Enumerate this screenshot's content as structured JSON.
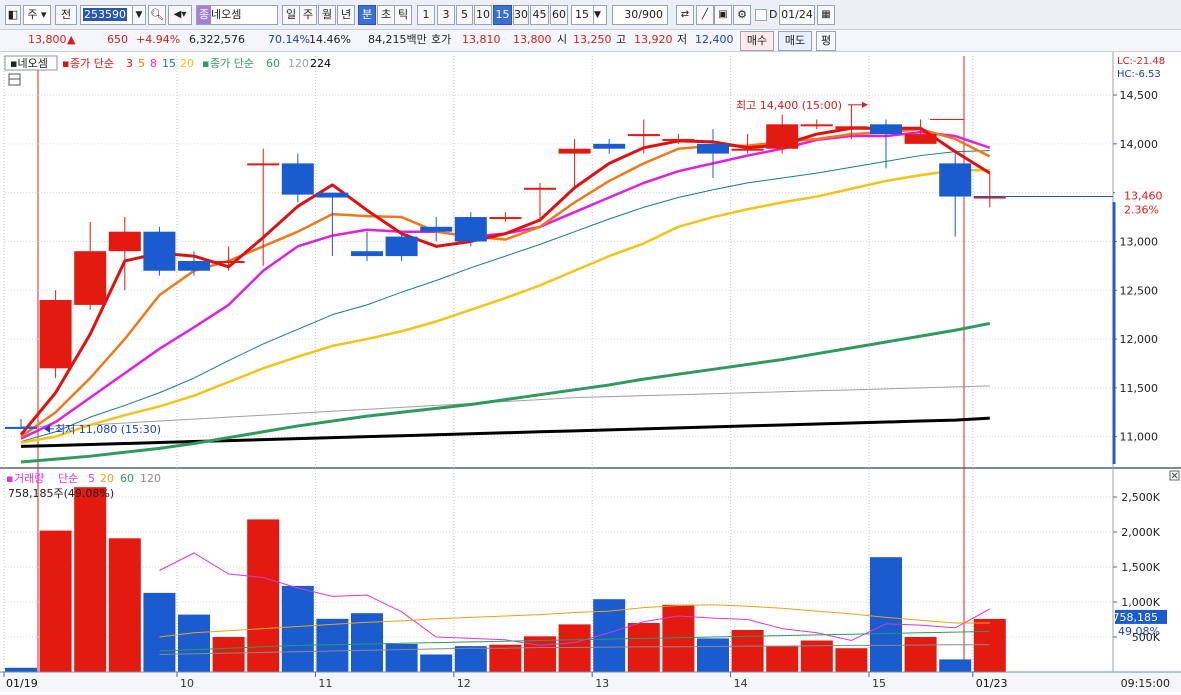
{
  "toolbar": {
    "market": "주",
    "all": "전",
    "code": "253590",
    "type_badge": "종",
    "stock_name": "네오셈",
    "periods": [
      "일",
      "주",
      "월",
      "년",
      "분",
      "초",
      "틱"
    ],
    "active_period": "분",
    "intervals": [
      "1",
      "3",
      "5",
      "10",
      "15",
      "30",
      "45",
      "60"
    ],
    "active_interval": "15",
    "interval_value": "15",
    "count": "30/900",
    "d_label": "D",
    "date": "01/24"
  },
  "quote": {
    "price": "13,800",
    "arrow": "▲",
    "change": "650",
    "change_rate": "+4.94%",
    "volume": "6,322,576",
    "vol_ratio": "70.14%",
    "turnover": "14.46%",
    "amount": "84,215백만",
    "ask_label": "호가",
    "ask1": "13,810",
    "bid1": "13,800",
    "open_label": "시",
    "open": "13,250",
    "high_label": "고",
    "high": "13,920",
    "low_label": "저",
    "low": "12,400",
    "buy_button": "매수",
    "sell_button": "매도",
    "eval_button": "평"
  },
  "legend": {
    "name": "네오셈",
    "ma_title": "종가 단순",
    "ma_periods": [
      "3",
      "5",
      "8",
      "15",
      "20"
    ],
    "ma_title2": "종가 단순",
    "ma_periods2": [
      "60",
      "120",
      "224"
    ]
  },
  "price_axis": {
    "ticks": [
      "14,500",
      "14,000",
      "13,500",
      "13,000",
      "12,500",
      "12,000",
      "11,500",
      "11,000"
    ],
    "lc": "LC:-21.48",
    "hc": "HC:-6.53",
    "current_price": "13,460",
    "current_pct": "2.36%"
  },
  "annotations": {
    "high": "최고 14,400 (15:00)",
    "low": "최저 11,080 (15:30)"
  },
  "volume_panel": {
    "title": "거래량",
    "ma_title": "단순",
    "ma_periods": [
      "5",
      "20",
      "60",
      "120"
    ],
    "info": "758,185주(49.08%)",
    "ticks": [
      "2,500K",
      "2,000K",
      "1,500K",
      "1,000K",
      "500K"
    ],
    "current_value": "758,185",
    "current_pct": "49.08%"
  },
  "x_axis": {
    "labels": [
      "01/19",
      "10",
      "11",
      "12",
      "13",
      "14",
      "15",
      "01/23"
    ],
    "time": "09:15:00"
  },
  "colors": {
    "up": "#e31a10",
    "down": "#1a5bd0",
    "ma3": "#e01010",
    "ma5": "#f07818",
    "ma8": "#e020e0",
    "ma15": "#157f7f",
    "ma20": "#f2c418",
    "ma60": "#2e9a5e",
    "ma120": "#a0a0a0",
    "ma224": "#000000"
  },
  "chart_data": {
    "type": "candlestick",
    "x": [
      "01/19",
      "",
      "",
      "",
      "",
      "",
      "",
      "",
      "",
      "",
      "",
      "",
      "",
      "",
      "",
      "",
      "",
      "",
      "",
      "",
      "",
      "",
      "",
      "",
      "",
      "",
      "",
      "",
      "01/23"
    ],
    "open": [
      11100,
      11700,
      12350,
      12900,
      13100,
      12800,
      12800,
      13800,
      13800,
      13500,
      12900,
      13050,
      13150,
      13250,
      13250,
      13550,
      13900,
      14000,
      14100,
      14050,
      14000,
      13950,
      13950,
      14200,
      14150,
      14200,
      14000,
      13800,
      13460
    ],
    "close": [
      11090,
      12400,
      12900,
      13100,
      12700,
      12700,
      12800,
      13800,
      13480,
      13450,
      12850,
      12850,
      13100,
      13000,
      13250,
      13550,
      13950,
      13950,
      14100,
      14050,
      13900,
      13950,
      14200,
      14200,
      14180,
      14100,
      14100,
      13460,
      13460
    ],
    "high": [
      11180,
      12500,
      13200,
      13250,
      13150,
      12900,
      12950,
      13950,
      13900,
      13500,
      13100,
      13100,
      13250,
      13300,
      13300,
      13600,
      14050,
      14050,
      14250,
      14100,
      14150,
      14100,
      14300,
      14250,
      14400,
      14250,
      14250,
      13900,
      13700
    ],
    "low": [
      11080,
      11600,
      12300,
      12500,
      12650,
      12650,
      12700,
      12750,
      13400,
      12850,
      12800,
      12800,
      13000,
      12950,
      13200,
      13200,
      13550,
      13900,
      13900,
      14000,
      13650,
      13900,
      13900,
      14150,
      14050,
      13750,
      14000,
      13050,
      13350
    ],
    "series": [
      {
        "name": "3",
        "values": [
          11020,
          11450,
          12050,
          12800,
          12880,
          12850,
          12740,
          13040,
          13360,
          13580,
          13320,
          13080,
          12950,
          13000,
          13080,
          13220,
          13550,
          13800,
          13960,
          14030,
          14020,
          13960,
          13990,
          14100,
          14160,
          14160,
          14160,
          13920,
          13700
        ]
      },
      {
        "name": "5",
        "values": [
          11000,
          11250,
          11600,
          12000,
          12450,
          12700,
          12800,
          12950,
          13100,
          13280,
          13260,
          13250,
          13100,
          13050,
          13020,
          13150,
          13400,
          13620,
          13800,
          13950,
          13980,
          13980,
          14020,
          14050,
          14100,
          14120,
          14150,
          14050,
          13870
        ]
      },
      {
        "name": "8",
        "values": [
          10980,
          11150,
          11400,
          11650,
          11900,
          12120,
          12350,
          12700,
          12950,
          13060,
          13120,
          13100,
          13100,
          13050,
          13080,
          13150,
          13300,
          13450,
          13600,
          13720,
          13800,
          13880,
          13950,
          14040,
          14080,
          14080,
          14120,
          14080,
          13960
        ]
      },
      {
        "name": "15",
        "values": [
          10950,
          11050,
          11200,
          11320,
          11450,
          11600,
          11780,
          11950,
          12100,
          12250,
          12350,
          12480,
          12600,
          12730,
          12850,
          12970,
          13100,
          13230,
          13350,
          13450,
          13530,
          13600,
          13650,
          13700,
          13760,
          13820,
          13880,
          13920,
          13930
        ]
      },
      {
        "name": "20",
        "values": [
          10940,
          11000,
          11120,
          11220,
          11310,
          11420,
          11560,
          11700,
          11820,
          11930,
          12000,
          12080,
          12180,
          12300,
          12420,
          12550,
          12700,
          12850,
          12980,
          13150,
          13250,
          13330,
          13400,
          13460,
          13540,
          13620,
          13680,
          13730,
          13730
        ]
      },
      {
        "name": "60",
        "values": [
          10740,
          10770,
          10800,
          10840,
          10880,
          10930,
          10990,
          11050,
          11110,
          11160,
          11210,
          11250,
          11290,
          11330,
          11380,
          11430,
          11480,
          11530,
          11590,
          11640,
          11690,
          11740,
          11790,
          11850,
          11910,
          11970,
          12030,
          12090,
          12160
        ]
      },
      {
        "name": "120",
        "values": [
          11100,
          11110,
          11120,
          11140,
          11160,
          11180,
          11200,
          11220,
          11240,
          11260,
          11280,
          11300,
          11320,
          11340,
          11360,
          11380,
          11400,
          11410,
          11420,
          11430,
          11440,
          11450,
          11460,
          11470,
          11480,
          11490,
          11500,
          11510,
          11520
        ]
      },
      {
        "name": "224",
        "values": [
          10900,
          10910,
          10920,
          10930,
          10940,
          10950,
          10960,
          10970,
          10980,
          10990,
          11000,
          11010,
          11020,
          11030,
          11040,
          11050,
          11060,
          11070,
          11080,
          11090,
          11100,
          11110,
          11120,
          11130,
          11140,
          11150,
          11160,
          11170,
          11190
        ]
      }
    ],
    "volume": [
      60000,
      2020000,
      2640000,
      1910000,
      1130000,
      820000,
      500000,
      2180000,
      1230000,
      760000,
      840000,
      400000,
      250000,
      370000,
      390000,
      510000,
      680000,
      1040000,
      700000,
      960000,
      480000,
      600000,
      370000,
      450000,
      340000,
      1640000,
      500000,
      180000,
      758185
    ],
    "volume_ma": [
      {
        "name": "5",
        "values": [
          null,
          null,
          null,
          null,
          1450000,
          1700000,
          1400000,
          1350000,
          1200000,
          1080000,
          1100000,
          860000,
          500000,
          480000,
          460000,
          380000,
          420000,
          560000,
          720000,
          800000,
          770000,
          750000,
          620000,
          560000,
          450000,
          690000,
          670000,
          630000,
          900000
        ]
      },
      {
        "name": "20",
        "values": [
          null,
          null,
          null,
          null,
          500000,
          560000,
          590000,
          620000,
          650000,
          680000,
          710000,
          730000,
          760000,
          780000,
          800000,
          820000,
          850000,
          870000,
          920000,
          950000,
          960000,
          940000,
          910000,
          870000,
          830000,
          780000,
          740000,
          700000,
          700000
        ]
      },
      {
        "name": "60",
        "values": [
          null,
          null,
          null,
          null,
          300000,
          320000,
          340000,
          360000,
          380000,
          390000,
          400000,
          410000,
          420000,
          430000,
          440000,
          450000,
          460000,
          470000,
          480000,
          490000,
          500000,
          510000,
          520000,
          530000,
          540000,
          550000,
          560000,
          570000,
          580000
        ]
      },
      {
        "name": "120",
        "values": [
          null,
          null,
          null,
          null,
          250000,
          260000,
          270000,
          280000,
          290000,
          300000,
          310000,
          320000,
          330000,
          340000,
          340000,
          350000,
          350000,
          355000,
          360000,
          360000,
          365000,
          370000,
          370000,
          375000,
          380000,
          380000,
          385000,
          390000,
          390000
        ]
      }
    ],
    "price_ylim": [
      10720,
      14900
    ],
    "volume_ylim": [
      0,
      2900000
    ],
    "grid": true
  }
}
